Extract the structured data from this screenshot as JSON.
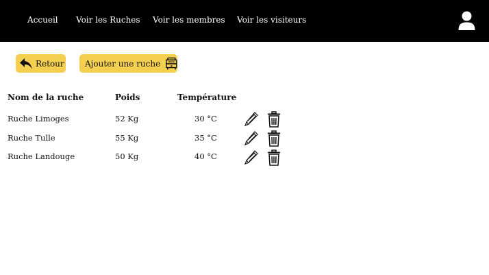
{
  "nav": {
    "items": [
      "Accueil",
      "Voir les Ruches",
      "Voir les membres",
      "Voir les visiteurs"
    ],
    "account_icon": "user-icon"
  },
  "actions": {
    "back_label": "Retour",
    "back_icon": "reply-arrow-icon",
    "add_label": "Ajouter une ruche",
    "add_icon": "beehive-icon"
  },
  "table": {
    "headers": [
      "Nom de la ruche",
      "Poids",
      "Température"
    ],
    "rows": [
      [
        "Ruche Limoges",
        "52 Kg",
        "30 °C"
      ],
      [
        "Ruche Tulle",
        "55 Kg",
        "35 °C"
      ],
      [
        "Ruche Landouge",
        "50 Kg",
        "40 °C"
      ]
    ],
    "row_icons": [
      "pencil-icon",
      "trash-icon"
    ]
  },
  "colors": {
    "navbar": "#000000",
    "button": "#f5cf4f"
  }
}
